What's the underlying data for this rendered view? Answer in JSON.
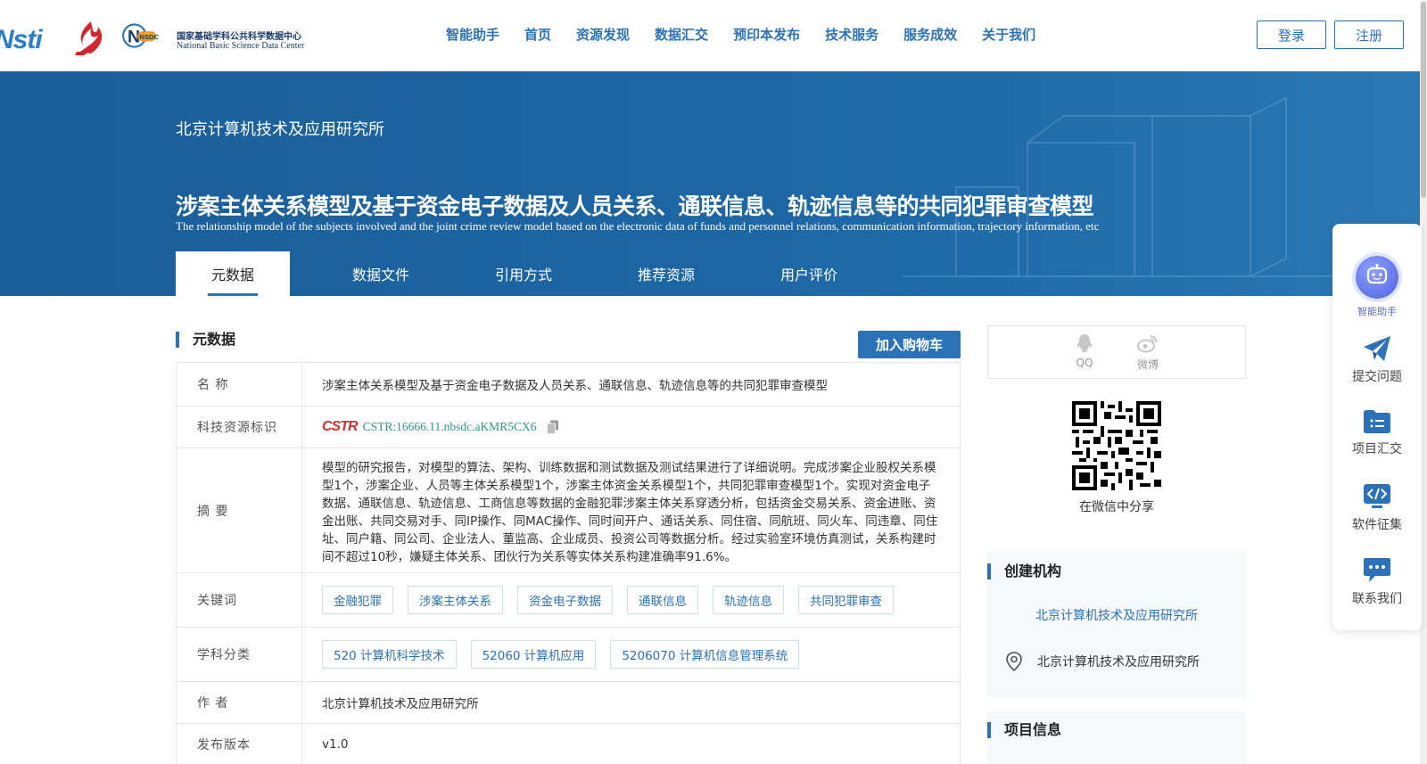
{
  "header": {
    "logo_nsti": "Nsti",
    "logo_nsdc_cn": "国家基础学科公共科学数据中心",
    "logo_nsdc_en": "National Basic Science Data Center",
    "logo_nsdc_mark": "NSDC",
    "nav": [
      "智能助手",
      "首页",
      "资源发现",
      "数据汇交",
      "预印本发布",
      "技术服务",
      "服务成效",
      "关于我们"
    ],
    "login": "登录",
    "register": "注册"
  },
  "banner": {
    "org": "北京计算机技术及应用研究所",
    "title": "涉案主体关系模型及基于资金电子数据及人员关系、通联信息、轨迹信息等的共同犯罪审查模型",
    "title_en": "The relationship model of the subjects involved and the joint crime review model based on the electronic data of funds and personnel relations, communication information, trajectory information, etc",
    "tabs": [
      "元数据",
      "数据文件",
      "引用方式",
      "推荐资源",
      "用户评价"
    ]
  },
  "metadata": {
    "section_title": "元数据",
    "cart_button": "加入购物车",
    "name_label": "名 称",
    "name_value": "涉案主体关系模型及基于资金电子数据及人员关系、通联信息、轨迹信息等的共同犯罪审查模型",
    "id_label": "科技资源标识",
    "id_logo": "CSTR",
    "id_value": "CSTR:16666.11.nbsdc.aKMR5CX6",
    "abstract_label": "摘 要",
    "abstract_value": "模型的研究报告，对模型的算法、架构、训练数据和测试数据及测试结果进行了详细说明。完成涉案企业股权关系模型1个，涉案企业、人员等主体关系模型1个，涉案主体资金关系模型1个，共同犯罪审查模型1个。实现对资金电子数据、通联信息、轨迹信息、工商信息等数据的金融犯罪涉案主体关系穿透分析，包括资金交易关系、资金进账、资金出账、共同交易对手、同IP操作、同MAC操作、同时间开户、通话关系、同住宿、同航班、同火车、同违章、同住址、同户籍、同公司、企业法人、董监高、企业成员、投资公司等数据分析。经过实验室环境仿真测试，关系构建时间不超过10秒，嫌疑主体关系、团伙行为关系等实体关系构建准确率91.6%。",
    "keywords_label": "关键词",
    "keywords": [
      "金融犯罪",
      "涉案主体关系",
      "资金电子数据",
      "通联信息",
      "轨迹信息",
      "共同犯罪审查"
    ],
    "subject_label": "学科分类",
    "subjects": [
      "520 计算机科学技术",
      "52060 计算机应用",
      "5206070 计算机信息管理系统"
    ],
    "author_label": "作 者",
    "author_value": "北京计算机技术及应用研究所",
    "version_label": "发布版本",
    "version_value": "v1.0"
  },
  "share": {
    "qq": "QQ",
    "weibo": "微博",
    "wechat_caption": "在微信中分享"
  },
  "org_box": {
    "title": "创建机构",
    "link": "北京计算机技术及应用研究所",
    "location": "北京计算机技术及应用研究所"
  },
  "project_box": {
    "title": "项目信息"
  },
  "side_panel": {
    "ai": "智能助手",
    "question": "提交问题",
    "project": "项目汇交",
    "software": "软件征集",
    "contact": "联系我们"
  },
  "colors": {
    "primary": "#2b72b8",
    "banner": "#1d68a6",
    "cstr_red": "#d3322f",
    "cstr_teal": "#2d9688"
  }
}
